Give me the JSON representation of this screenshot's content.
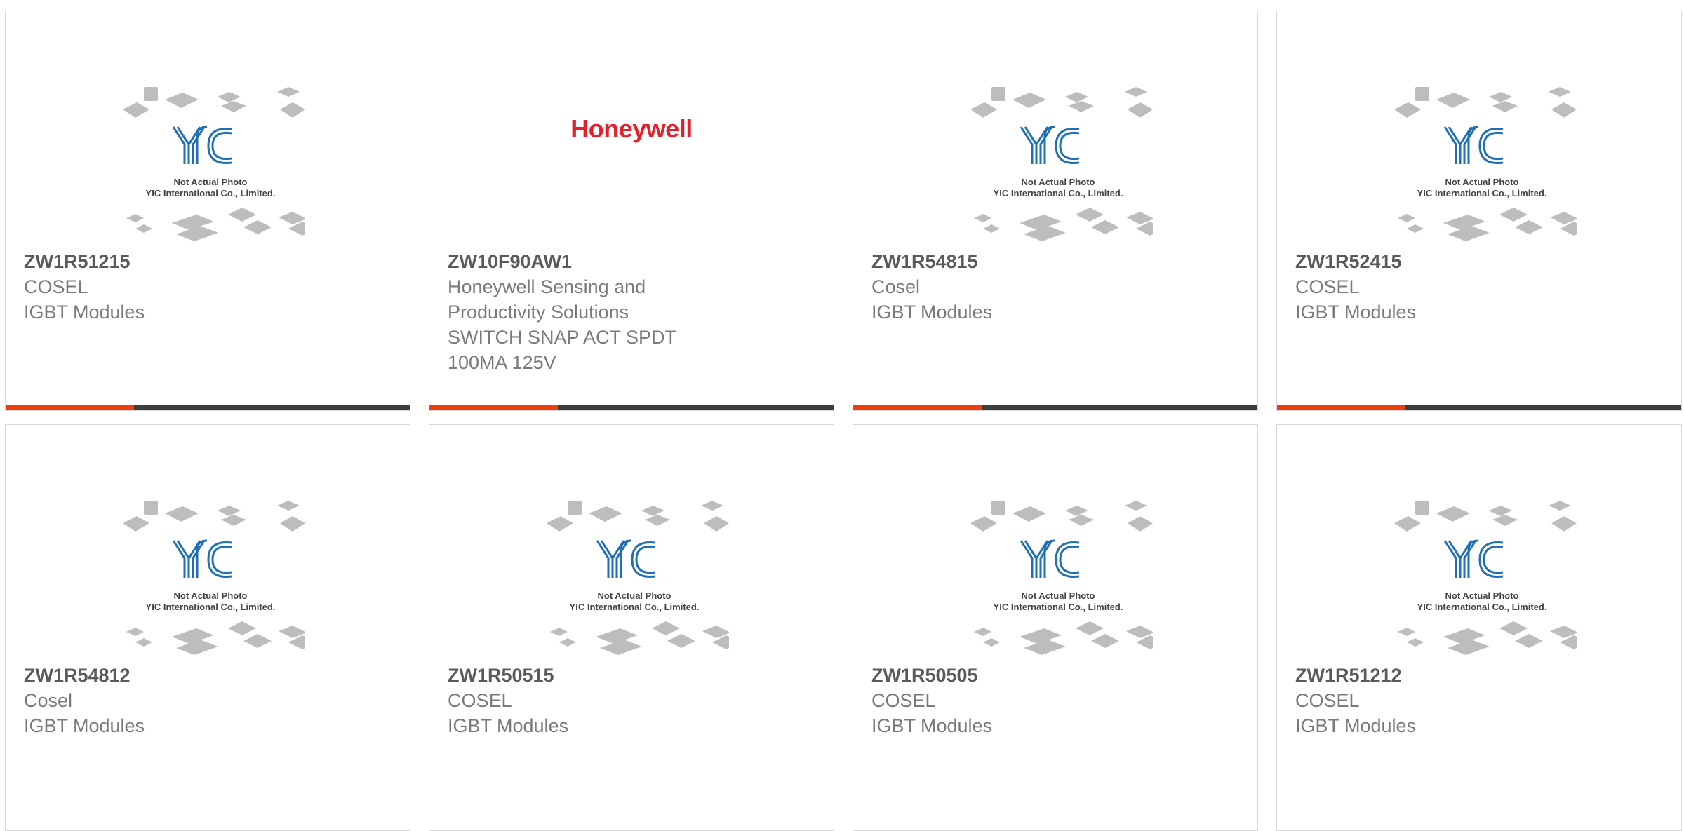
{
  "products": [
    {
      "part": "ZW1R51215",
      "maker": "COSEL",
      "desc": [
        "IGBT Modules"
      ],
      "image": "placeholder"
    },
    {
      "part": "ZW10F90AW1",
      "maker": "Honeywell Sensing and Productivity Solutions",
      "maker_lines": [
        "Honeywell Sensing and",
        "Productivity Solutions"
      ],
      "desc": [
        "SWITCH SNAP ACT SPDT",
        "100MA 125V"
      ],
      "image": "logo",
      "logo_text": "Honeywell"
    },
    {
      "part": "ZW1R54815",
      "maker": "Cosel",
      "desc": [
        "IGBT Modules"
      ],
      "image": "placeholder"
    },
    {
      "part": "ZW1R52415",
      "maker": "COSEL",
      "desc": [
        "IGBT Modules"
      ],
      "image": "placeholder"
    },
    {
      "part": "ZW1R54812",
      "maker": "Cosel",
      "desc": [
        "IGBT Modules"
      ],
      "image": "placeholder"
    },
    {
      "part": "ZW1R50515",
      "maker": "COSEL",
      "desc": [
        "IGBT Modules"
      ],
      "image": "placeholder"
    },
    {
      "part": "ZW1R50505",
      "maker": "COSEL",
      "desc": [
        "IGBT Modules"
      ],
      "image": "placeholder"
    },
    {
      "part": "ZW1R51212",
      "maker": "COSEL",
      "desc": [
        "IGBT Modules"
      ],
      "image": "placeholder"
    }
  ],
  "placeholder": {
    "line1": "Not Actual Photo",
    "line2": "YIC International Co., Limited.",
    "logo": "YIC"
  },
  "colors": {
    "accent": "#e8410c",
    "bar": "#3d3d3d",
    "honeywell_red": "#e4202a",
    "yic_blue": "#1f6fb6"
  }
}
